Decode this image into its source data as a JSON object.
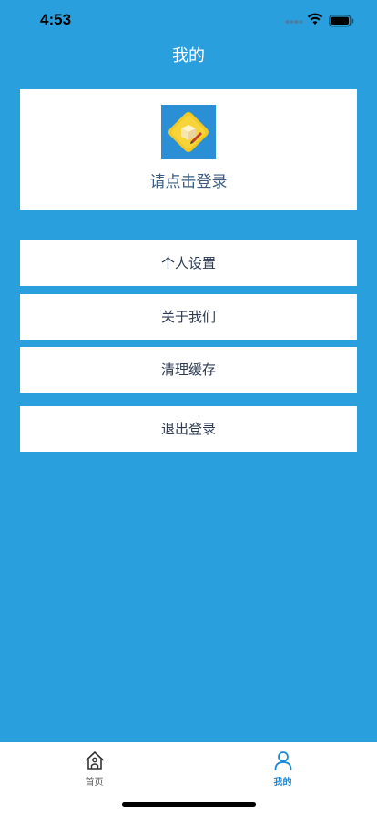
{
  "status_bar": {
    "time": "4:53"
  },
  "nav": {
    "title": "我的"
  },
  "profile": {
    "login_prompt": "请点击登录"
  },
  "menu": [
    {
      "label": "个人设置"
    },
    {
      "label": "关于我们"
    },
    {
      "label": "清理缓存"
    },
    {
      "label": "退出登录"
    }
  ],
  "tabs": [
    {
      "label": "首页",
      "icon": "home-icon",
      "active": false
    },
    {
      "label": "我的",
      "icon": "person-icon",
      "active": true
    }
  ],
  "colors": {
    "background": "#2a9fdd",
    "active_tab": "#1a8ad6",
    "inactive_tab": "#555555",
    "menu_text": "#2d3a52"
  }
}
